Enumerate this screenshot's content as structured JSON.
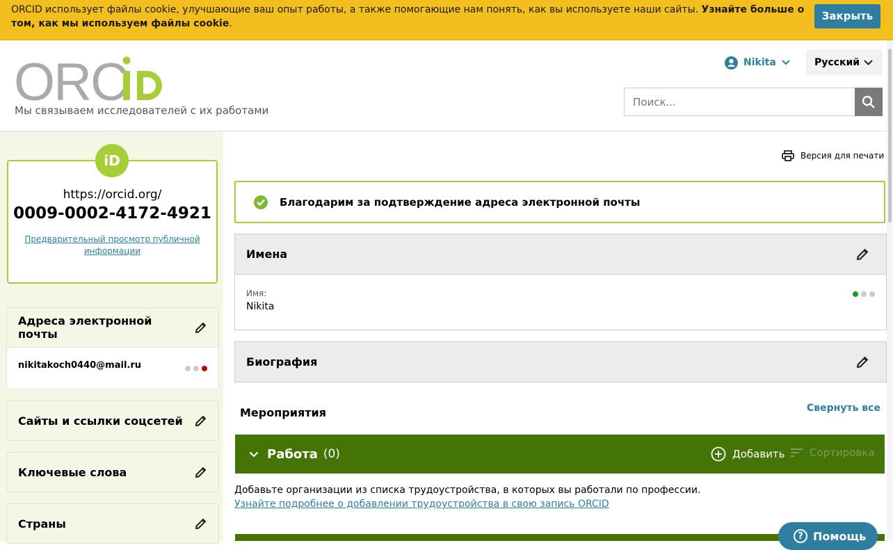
{
  "cookie_banner": {
    "text": "ORCID использует файлы cookie, улучшающие ваш опыт работы, а также помогающие нам понять, как вы используете наши сайты. ",
    "link_text": "Узнайте больше о том, как мы используем файлы cookie",
    "suffix": ".",
    "close_label": "Закрыть"
  },
  "header": {
    "logo_text": "ORCID",
    "tagline": "Мы связываем исследователей с их работами",
    "user_name": "Nikita",
    "language": "Русский",
    "search_placeholder": "Поиск..."
  },
  "sidebar": {
    "id_badge": "iD",
    "orcid_url": "https://orcid.org/",
    "orcid_id": "0009-0002-4172-4921",
    "preview_link": "Предварительный просмотр публичной информации",
    "emails_title": "Адреса электронной почты",
    "email": "nikitakoch0440@mail.ru",
    "websites_title": "Сайты и ссылки соцсетей",
    "keywords_title": "Ключевые слова",
    "countries_title": "Страны"
  },
  "main": {
    "print_label": "Версия для печати",
    "notice": "Благодарим за подтверждение адреса электронной почты",
    "names_title": "Имена",
    "name_label": "Имя:",
    "name_value": "Nikita",
    "bio_title": "Биография",
    "activities_title": "Мероприятия",
    "collapse_all": "Свернуть все",
    "work_title": "Работа",
    "work_count": "(0)",
    "add_label": "Добавить",
    "sort_label": "Сортировка",
    "work_desc": "Добавьте организации из списка трудоустройства, в которых вы работали по профессии.",
    "work_link": "Узнайте подробнее о добавлении трудоустройства в свою запись ORCID"
  },
  "help_label": "Помощь",
  "colors": {
    "accent": "#2e7f9f",
    "brand_green": "#a6ce39",
    "section_green": "#447405",
    "banner": "#f2bf1f"
  }
}
